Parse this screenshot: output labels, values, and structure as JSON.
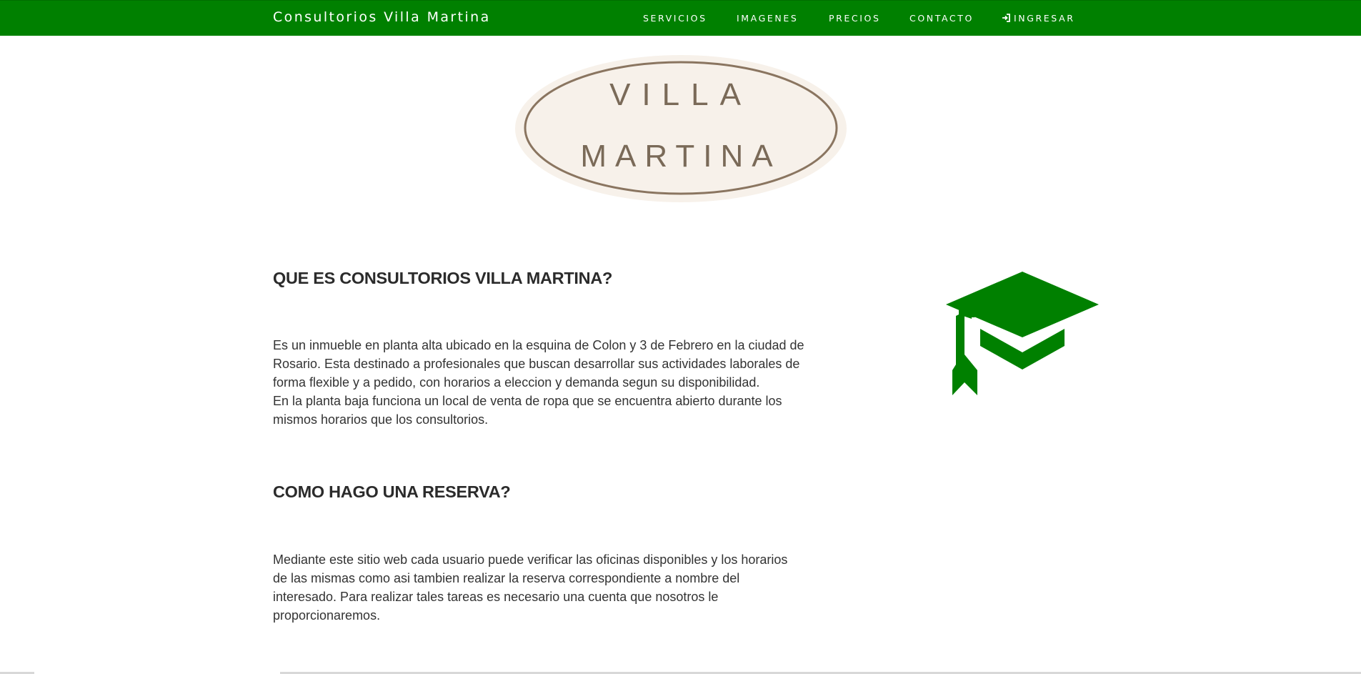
{
  "navbar": {
    "brand": "Consultorios Villa Martina",
    "links": [
      {
        "label": "SERVICIOS"
      },
      {
        "label": "IMAGENES"
      },
      {
        "label": "PRECIOS"
      },
      {
        "label": "CONTACTO"
      },
      {
        "label": "INGRESAR",
        "icon": "sign-in-icon"
      }
    ]
  },
  "logo": {
    "line1": "VILLA",
    "line2": "MARTINA"
  },
  "sections": [
    {
      "title": "QUE ES CONSULTORIOS VILLA MARTINA?",
      "lines": [
        "Es un inmueble en planta alta ubicado en la esquina de Colon y 3 de Febrero en la ciudad de",
        "Rosario. Esta destinado a profesionales que buscan desarrollar sus actividades laborales de",
        "forma flexible y a pedido, con horarios a eleccion y demanda segun su disponibilidad.",
        "En la planta baja funciona un local de venta de ropa que se encuentra abierto durante los",
        "mismos horarios que los consultorios."
      ]
    },
    {
      "title": "COMO HAGO UNA RESERVA?",
      "lines": [
        "Mediante este sitio web cada usuario puede verificar las oficinas disponibles y los horarios",
        "de las mismas como asi tambien realizar la reserva correspondiente a nombre del",
        "interesado. Para realizar tales tareas es necesario una cuenta que nosotros le",
        "proporcionaremos."
      ]
    }
  ],
  "colors": {
    "brand_green": "#008000",
    "logo_brown": "#8a7560",
    "logo_bg": "#f7f1ea"
  },
  "icons": {
    "feature": "graduation-cap-icon",
    "login": "sign-in-icon"
  }
}
